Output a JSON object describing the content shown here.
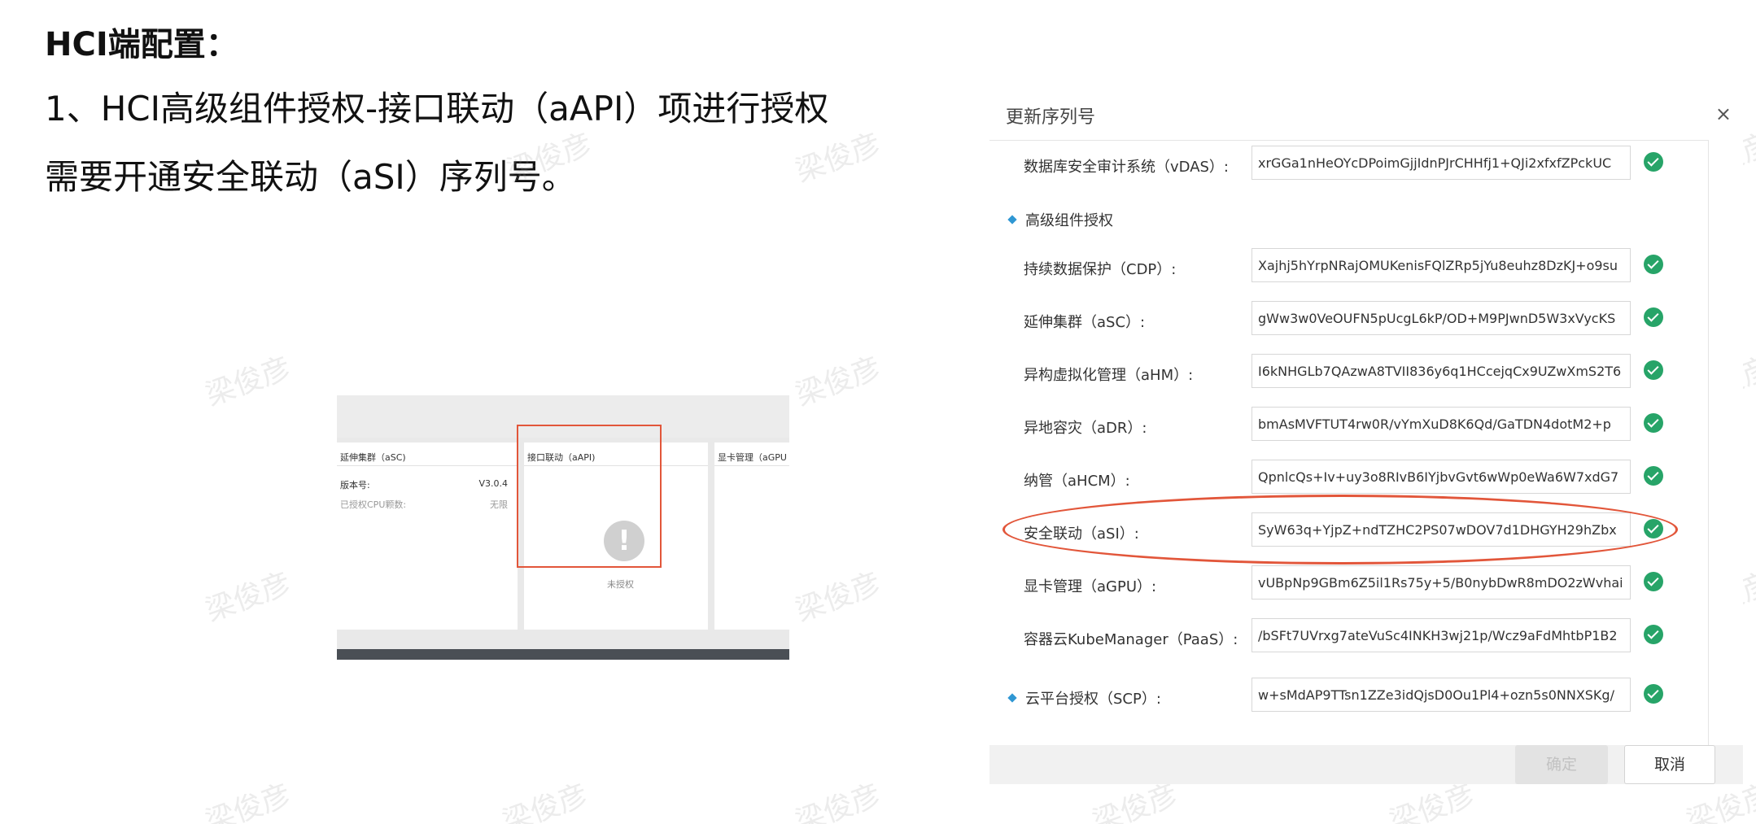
{
  "slide": {
    "heading": "HCI端配置：",
    "line1": "1、HCI高级组件授权-接口联动（aAPI）项进行授权",
    "line2": "需要开通安全联动（aSI）序列号。"
  },
  "watermark": "梁俊彦",
  "mini_screenshot": {
    "panel1": {
      "title": "延伸集群（aSC)",
      "version_label": "版本号:",
      "version_value": "V3.0.4",
      "cpu_label": "已授权CPU颗数:",
      "cpu_value": "无限"
    },
    "panel2": {
      "title": "接口联动（aAPI)",
      "alert_icon": "exclamation-icon",
      "status": "未授权"
    },
    "panel3": {
      "title": "显卡管理（aGPU"
    }
  },
  "dialog": {
    "title": "更新序列号",
    "close": "×",
    "rows_top": [
      {
        "label": "数据库安全审计系统（vDAS）:",
        "value": "xrGGa1nHeOYcDPoimGjjIdnPJrCHHfj1+QJi2xfxfZPckUC"
      }
    ],
    "section_advanced": "高级组件授权",
    "rows_advanced": [
      {
        "label": "持续数据保护（CDP）:",
        "value": "Xajhj5hYrpNRajOMUKenisFQlZRp5jYu8euhz8DzKJ+o9su"
      },
      {
        "label": "延伸集群（aSC）:",
        "value": "gWw3w0VeOUFN5pUcgL6kP/OD+M9PJwnD5W3xVycKS"
      },
      {
        "label": "异构虚拟化管理（aHM）:",
        "value": "I6kNHGLb7QAzwA8TVII836y6q1HCcejqCx9UZwXmS2T6"
      },
      {
        "label": "异地容灾（aDR）:",
        "value": "bmAsMVFTUT4rw0R/vYmXuD8K6Qd/GaTDN4dotM2+p"
      },
      {
        "label": "纳管（aHCM）:",
        "value": "QpnlcQs+Iv+uy3o8RIvB6IYjbvGvt6wWp0eWa6W7xdG7"
      },
      {
        "label": "安全联动（aSI）:",
        "value": "SyW63q+YjpZ+ndTZHC2PS07wDOV7d1DHGYH29hZbx"
      },
      {
        "label": "显卡管理（aGPU）:",
        "value": "vUBpNp9GBm6Z5il1Rs75y+5/B0nybDwR8mDO2zWvhai"
      },
      {
        "label": "容器云KubeManager（PaaS）:",
        "value": "/bSFt7UVrxg7ateVuSc4INKH3wj21p/Wcz9aFdMhtbP1B2"
      }
    ],
    "row_scp": {
      "label": "云平台授权（SCP）:",
      "value": "w+sMdAP9TTsn1ZZe3idQjsD0Ou1Pl4+ozn5s0NNXSKg/"
    },
    "ok_button": "确定",
    "cancel_button": "取消"
  }
}
